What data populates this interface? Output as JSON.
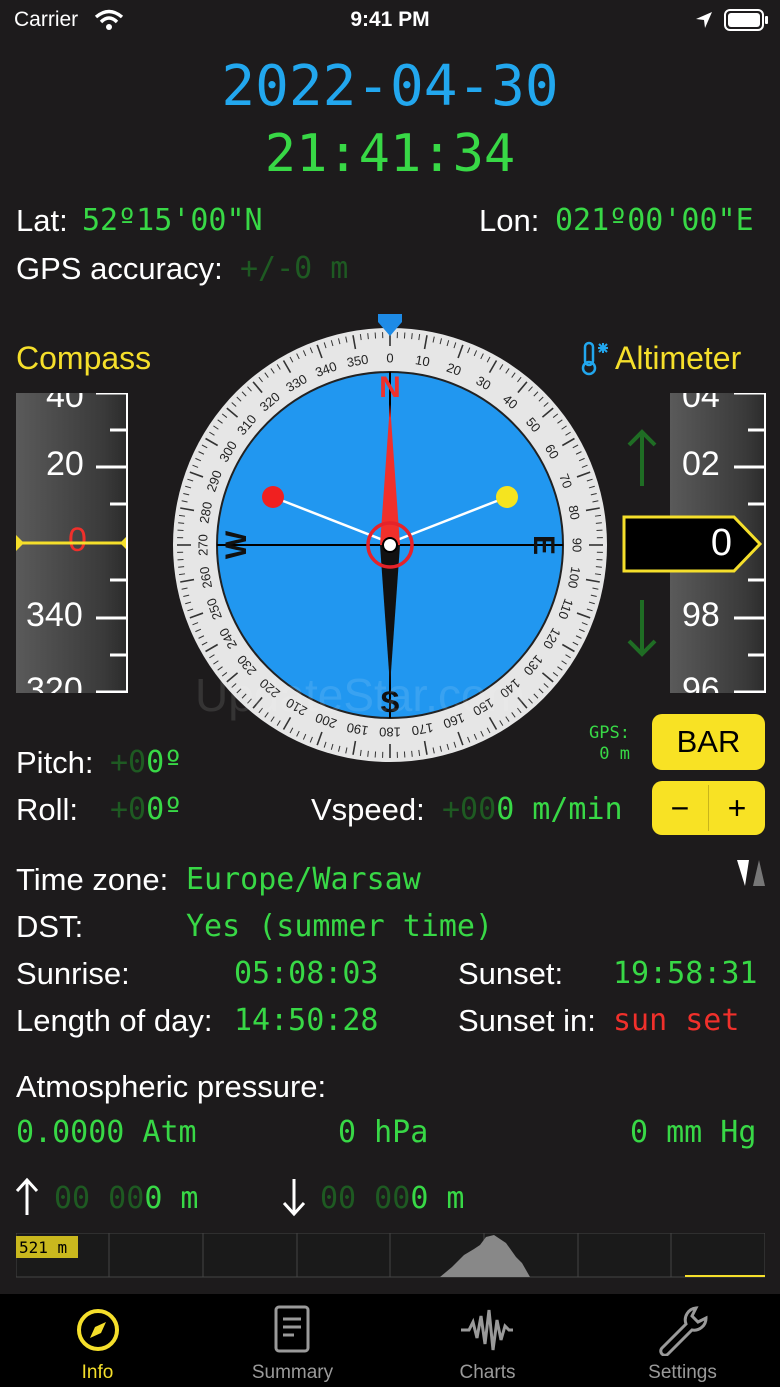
{
  "status_bar": {
    "carrier": "Carrier",
    "time": "9:41 PM"
  },
  "header": {
    "date": "2022-04-30",
    "time": "21:41:34"
  },
  "location": {
    "lat_label": "Lat:",
    "lat_value": "52º15'00\"N",
    "lon_label": "Lon:",
    "lon_value": "021º00'00\"E",
    "gps_accuracy_label": "GPS accuracy:",
    "gps_accuracy_value": "+/-0 m"
  },
  "compass": {
    "title": "Compass",
    "tape_labels": [
      "40",
      "20",
      "0",
      "340",
      "320"
    ],
    "cardinal": {
      "n": "N",
      "e": "E",
      "s": "S",
      "w": "W"
    },
    "dial_labels": [
      "0",
      "10",
      "20",
      "30",
      "40",
      "50",
      "60",
      "70",
      "80",
      "90",
      "100",
      "110",
      "120",
      "130",
      "140",
      "150",
      "160",
      "170",
      "180",
      "190",
      "200",
      "210",
      "220",
      "230",
      "240",
      "250",
      "260",
      "270",
      "280",
      "290",
      "300",
      "310",
      "320",
      "330",
      "340",
      "350"
    ],
    "heading_deg": 0
  },
  "altimeter": {
    "title": "Altimeter",
    "tape_labels": [
      "04",
      "02",
      "98",
      "96"
    ],
    "current": "0",
    "gps_label": "GPS:",
    "gps_value": "0 m",
    "bar_button": "BAR",
    "minus_button": "−",
    "plus_button": "+"
  },
  "attitude": {
    "pitch_label": "Pitch:",
    "pitch_dim": "+0",
    "pitch_value": "0º",
    "roll_label": "Roll:",
    "roll_dim": "+0",
    "roll_value": "0º",
    "vspeed_label": "Vspeed:",
    "vspeed_dim": "+00",
    "vspeed_value": "0 m/min"
  },
  "sun": {
    "timezone_label": "Time zone:",
    "timezone_value": "Europe/Warsaw",
    "dst_label": "DST:",
    "dst_value": "Yes (summer time)",
    "sunrise_label": "Sunrise:",
    "sunrise_value": "05:08:03",
    "sunset_label": "Sunset:",
    "sunset_value": "19:58:31",
    "length_label": "Length of day:",
    "length_value": "14:50:28",
    "sunset_in_label": "Sunset in:",
    "sunset_in_value": "sun set"
  },
  "pressure": {
    "title": "Atmospheric pressure:",
    "atm": "0.0000 Atm",
    "hpa": "0 hPa",
    "mmhg": "0 mm Hg"
  },
  "elevation": {
    "up_dim": "00 00",
    "up_value": "0 m",
    "down_dim": "00 00",
    "down_value": "0 m",
    "profile_label": "521 m"
  },
  "watermark": "UpdateStar.com",
  "tabs": [
    {
      "label": "Info",
      "icon": "compass-icon"
    },
    {
      "label": "Summary",
      "icon": "document-icon"
    },
    {
      "label": "Charts",
      "icon": "waveform-icon"
    },
    {
      "label": "Settings",
      "icon": "wrench-icon"
    }
  ],
  "colors": {
    "accent_yellow": "#f5df2b",
    "green": "#38d846",
    "blue": "#22a7ee",
    "red": "#f0302b",
    "background": "#1d1b1c"
  }
}
